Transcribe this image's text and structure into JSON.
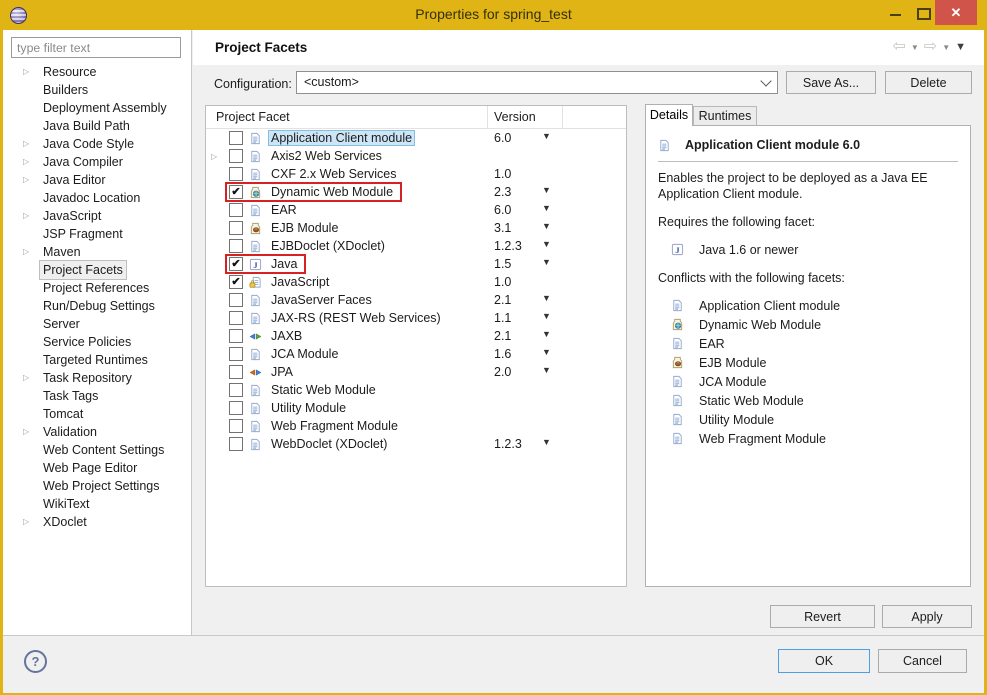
{
  "window": {
    "title": "Properties for spring_test",
    "controls": {
      "minimize": "minimize",
      "maximize": "maximize",
      "close": "✕"
    }
  },
  "colors": {
    "titlebar-gold": "#E0B414",
    "close-red": "#D1544B",
    "annotation-red": "#D62222",
    "selection-blue-bg": "#CDE6F7",
    "selection-blue-border": "#86BEE0",
    "ok-focus-blue": "#4F9EE3"
  },
  "sidebar": {
    "filter_text": "type filter text",
    "items": [
      {
        "label": "Resource",
        "expandable": true
      },
      {
        "label": "Builders"
      },
      {
        "label": "Deployment Assembly"
      },
      {
        "label": "Java Build Path"
      },
      {
        "label": "Java Code Style",
        "expandable": true
      },
      {
        "label": "Java Compiler",
        "expandable": true
      },
      {
        "label": "Java Editor",
        "expandable": true
      },
      {
        "label": "Javadoc Location"
      },
      {
        "label": "JavaScript",
        "expandable": true
      },
      {
        "label": "JSP Fragment"
      },
      {
        "label": "Maven",
        "expandable": true
      },
      {
        "label": "Project Facets",
        "selected": true
      },
      {
        "label": "Project References"
      },
      {
        "label": "Run/Debug Settings"
      },
      {
        "label": "Server"
      },
      {
        "label": "Service Policies"
      },
      {
        "label": "Targeted Runtimes"
      },
      {
        "label": "Task Repository",
        "expandable": true
      },
      {
        "label": "Task Tags"
      },
      {
        "label": "Tomcat"
      },
      {
        "label": "Validation",
        "expandable": true
      },
      {
        "label": "Web Content Settings"
      },
      {
        "label": "Web Page Editor"
      },
      {
        "label": "Web Project Settings"
      },
      {
        "label": "WikiText"
      },
      {
        "label": "XDoclet",
        "expandable": true
      }
    ]
  },
  "header": {
    "title": "Project Facets"
  },
  "toolbar": {
    "configuration_label": "Configuration:",
    "configuration_value": "<custom>",
    "save_as_label": "Save As...",
    "delete_label": "Delete"
  },
  "facet_table": {
    "columns": [
      "Project Facet",
      "Version"
    ],
    "rows": [
      {
        "label": "Application Client module",
        "icon": "doc",
        "checked": false,
        "version": "6.0",
        "version_dropdown": true,
        "expander": false,
        "selected": true,
        "red_box": false
      },
      {
        "label": "Axis2 Web Services",
        "icon": "doc",
        "checked": false,
        "version": "",
        "version_dropdown": false,
        "expander": true,
        "selected": false,
        "red_box": false
      },
      {
        "label": "CXF 2.x Web Services",
        "icon": "doc",
        "checked": false,
        "version": "1.0",
        "version_dropdown": false,
        "expander": false,
        "selected": false,
        "red_box": false
      },
      {
        "label": "Dynamic Web Module",
        "icon": "web",
        "checked": true,
        "version": "2.3",
        "version_dropdown": true,
        "expander": false,
        "selected": false,
        "red_box": true
      },
      {
        "label": "EAR",
        "icon": "doc",
        "checked": false,
        "version": "6.0",
        "version_dropdown": true,
        "expander": false,
        "selected": false,
        "red_box": false
      },
      {
        "label": "EJB Module",
        "icon": "ejb",
        "checked": false,
        "version": "3.1",
        "version_dropdown": true,
        "expander": false,
        "selected": false,
        "red_box": false
      },
      {
        "label": "EJBDoclet (XDoclet)",
        "icon": "doc",
        "checked": false,
        "version": "1.2.3",
        "version_dropdown": true,
        "expander": false,
        "selected": false,
        "red_box": false
      },
      {
        "label": "Java",
        "icon": "java",
        "checked": true,
        "version": "1.5",
        "version_dropdown": true,
        "expander": false,
        "selected": false,
        "red_box": true
      },
      {
        "label": "JavaScript",
        "icon": "jslock",
        "checked": true,
        "version": "1.0",
        "version_dropdown": false,
        "expander": false,
        "selected": false,
        "red_box": false
      },
      {
        "label": "JavaServer Faces",
        "icon": "doc",
        "checked": false,
        "version": "2.1",
        "version_dropdown": true,
        "expander": false,
        "selected": false,
        "red_box": false
      },
      {
        "label": "JAX-RS (REST Web Services)",
        "icon": "doc",
        "checked": false,
        "version": "1.1",
        "version_dropdown": true,
        "expander": false,
        "selected": false,
        "red_box": false
      },
      {
        "label": "JAXB",
        "icon": "jaxb",
        "checked": false,
        "version": "2.1",
        "version_dropdown": true,
        "expander": false,
        "selected": false,
        "red_box": false
      },
      {
        "label": "JCA Module",
        "icon": "doc",
        "checked": false,
        "version": "1.6",
        "version_dropdown": true,
        "expander": false,
        "selected": false,
        "red_box": false
      },
      {
        "label": "JPA",
        "icon": "jpa",
        "checked": false,
        "version": "2.0",
        "version_dropdown": true,
        "expander": false,
        "selected": false,
        "red_box": false
      },
      {
        "label": "Static Web Module",
        "icon": "doc",
        "checked": false,
        "version": "",
        "version_dropdown": false,
        "expander": false,
        "selected": false,
        "red_box": false
      },
      {
        "label": "Utility Module",
        "icon": "doc",
        "checked": false,
        "version": "",
        "version_dropdown": false,
        "expander": false,
        "selected": false,
        "red_box": false
      },
      {
        "label": "Web Fragment Module",
        "icon": "doc",
        "checked": false,
        "version": "",
        "version_dropdown": false,
        "expander": false,
        "selected": false,
        "red_box": false
      },
      {
        "label": "WebDoclet (XDoclet)",
        "icon": "doc",
        "checked": false,
        "version": "1.2.3",
        "version_dropdown": true,
        "expander": false,
        "selected": false,
        "red_box": false
      }
    ]
  },
  "details": {
    "tabs": [
      "Details",
      "Runtimes"
    ],
    "active_tab": "Details",
    "title": "Application Client module 6.0",
    "title_icon": "doc",
    "description": "Enables the project to be deployed as a Java EE Application Client module.",
    "requires_label": "Requires the following facet:",
    "requires": [
      {
        "icon": "java",
        "label": "Java 1.6 or newer"
      }
    ],
    "conflicts_label": "Conflicts with the following facets:",
    "conflicts": [
      {
        "icon": "doc",
        "label": "Application Client module"
      },
      {
        "icon": "web",
        "label": "Dynamic Web Module"
      },
      {
        "icon": "doc",
        "label": "EAR"
      },
      {
        "icon": "ejb",
        "label": "EJB Module"
      },
      {
        "icon": "doc",
        "label": "JCA Module"
      },
      {
        "icon": "doc",
        "label": "Static Web Module"
      },
      {
        "icon": "doc",
        "label": "Utility Module"
      },
      {
        "icon": "doc",
        "label": "Web Fragment Module"
      }
    ]
  },
  "actions": {
    "revert": "Revert",
    "apply": "Apply",
    "ok": "OK",
    "cancel": "Cancel"
  },
  "help_icon": "?"
}
